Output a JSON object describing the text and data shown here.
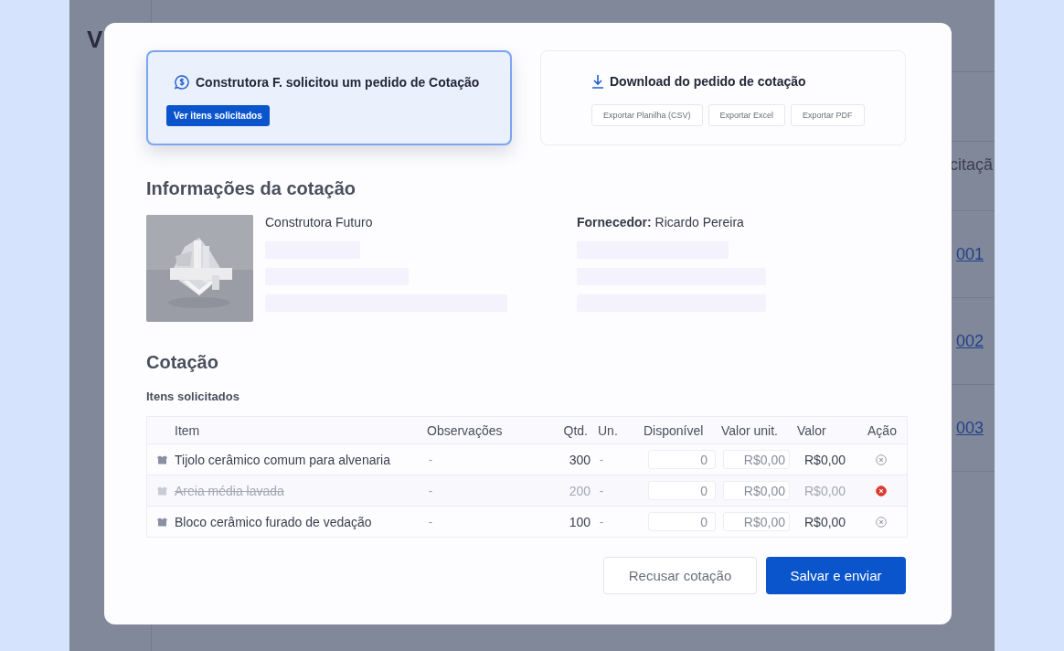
{
  "background": {
    "logo": "V",
    "column_heading": "citaçã",
    "links": [
      "001",
      "002",
      "003"
    ]
  },
  "request_card": {
    "title": "Construtora F. solicitou um pedido de Cotação",
    "button": "Ver itens solicitados"
  },
  "download_card": {
    "title": "Download do pedido de cotação",
    "buttons": [
      "Exportar Planilha (CSV)",
      "Exportar Excel",
      "Exportar PDF"
    ]
  },
  "info": {
    "heading": "Informações da cotação",
    "company": "Construtora Futuro",
    "supplier_label": "Fornecedor:",
    "supplier": "Ricardo Pereira"
  },
  "quote": {
    "heading": "Cotação",
    "subheading": "Itens solicitados",
    "table": {
      "columns": [
        "Item",
        "Observações",
        "Qtd.",
        "Un.",
        "Disponível",
        "Valor unit.",
        "Valor",
        "Ação"
      ],
      "rows": [
        {
          "item": "Tijolo cerâmico comum para alvenaria",
          "notes": "-",
          "qty": "300",
          "unit": "-",
          "available": "0",
          "unit_price": "R$0,00",
          "total": "R$0,00",
          "removed": false
        },
        {
          "item": "Areia média lavada",
          "notes": "-",
          "qty": "200",
          "unit": "-",
          "available": "0",
          "unit_price": "R$0,00",
          "total": "R$0,00",
          "removed": true
        },
        {
          "item": "Bloco cerâmico furado de vedação",
          "notes": "-",
          "qty": "100",
          "unit": "-",
          "available": "0",
          "unit_price": "R$0,00",
          "total": "R$0,00",
          "removed": false
        }
      ]
    }
  },
  "actions": {
    "decline": "Recusar cotação",
    "submit": "Salvar e enviar"
  }
}
